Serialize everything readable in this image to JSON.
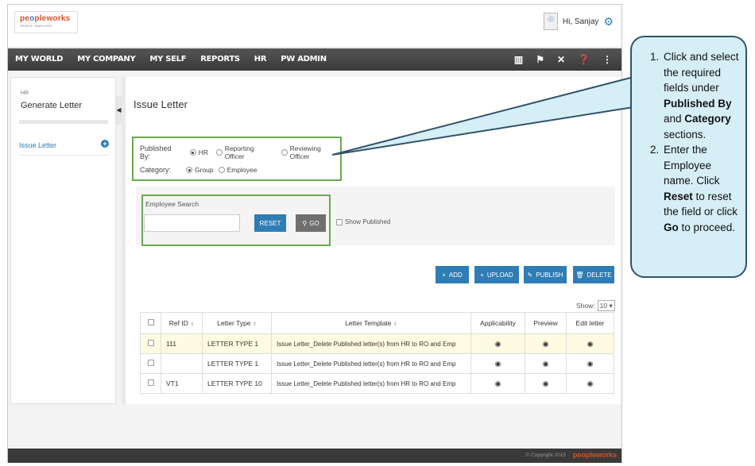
{
  "brand": {
    "logo_text_1": "pe",
    "logo_text_2": "o",
    "logo_text_3": "ple",
    "logo_text_4": "works",
    "logo_tagline": "PEOPLE. SIMPLIFIED."
  },
  "user": {
    "greeting": "Hi, Sanjay"
  },
  "nav": {
    "items": [
      "MY WORLD",
      "MY COMPANY",
      "MY SELF",
      "REPORTS",
      "HR",
      "PW ADMIN"
    ],
    "icons": [
      "book-icon",
      "flag-icon",
      "tools-icon",
      "help-icon",
      "share-icon"
    ]
  },
  "sidebar": {
    "section_small": "HR",
    "section_title": "Generate Letter",
    "items": [
      {
        "label": "Issue Letter"
      }
    ]
  },
  "main": {
    "title": "Issue Letter",
    "published_by": {
      "label": "Published By:",
      "options": [
        {
          "label": "HR",
          "checked": true
        },
        {
          "label": "Reporting Officer",
          "checked": false
        },
        {
          "label": "Reviewing Officer",
          "checked": false
        }
      ]
    },
    "category": {
      "label": "Category:",
      "options": [
        {
          "label": "Group",
          "checked": true
        },
        {
          "label": "Employee",
          "checked": false
        }
      ]
    },
    "search": {
      "label": "Employee Search",
      "value": "",
      "reset": "RESET",
      "go": "GO",
      "show_published": "Show Published"
    },
    "actions": {
      "add": "ADD",
      "upload": "UPLOAD",
      "publish": "PUBLISH",
      "delete": "DELETE"
    },
    "show": {
      "label": "Show:",
      "value": "10"
    },
    "table": {
      "headers": [
        "",
        "Ref ID",
        "Letter Type",
        "Letter Template",
        "Applicability",
        "Preview",
        "Edit letter"
      ],
      "rows": [
        {
          "ref": "111",
          "type": "LETTER TYPE 1",
          "template": "Issue Letter_Delete Published letter(s) from HR to RO and Emp",
          "highlight": true
        },
        {
          "ref": "",
          "type": "LETTER TYPE 1",
          "template": "Issue Letter_Delete Published letter(s) from HR to RO and Emp",
          "highlight": false
        },
        {
          "ref": "VT1",
          "type": "LETTER TYPE 10",
          "template": "Issue Letter_Delete Published letter(s) from HR to RO and Emp",
          "highlight": false
        }
      ]
    }
  },
  "footer": {
    "copyright": "© Copyright 2015",
    "brand": "peopleworks"
  },
  "callout": {
    "step1_a": "Click and select the required fields under ",
    "step1_b": "Published By",
    "step1_c": " and ",
    "step1_d": "Category",
    "step1_e": " sections.",
    "step2_a": "Enter the Employee name. Click ",
    "step2_b": "Reset",
    "step2_c": " to reset the field or click ",
    "step2_d": "Go",
    "step2_e": " to proceed."
  },
  "colors": {
    "accent": "#2f7db5",
    "highlight_box": "#6aa84f",
    "callout_bg": "#d6eef6",
    "callout_border": "#2f5369"
  }
}
